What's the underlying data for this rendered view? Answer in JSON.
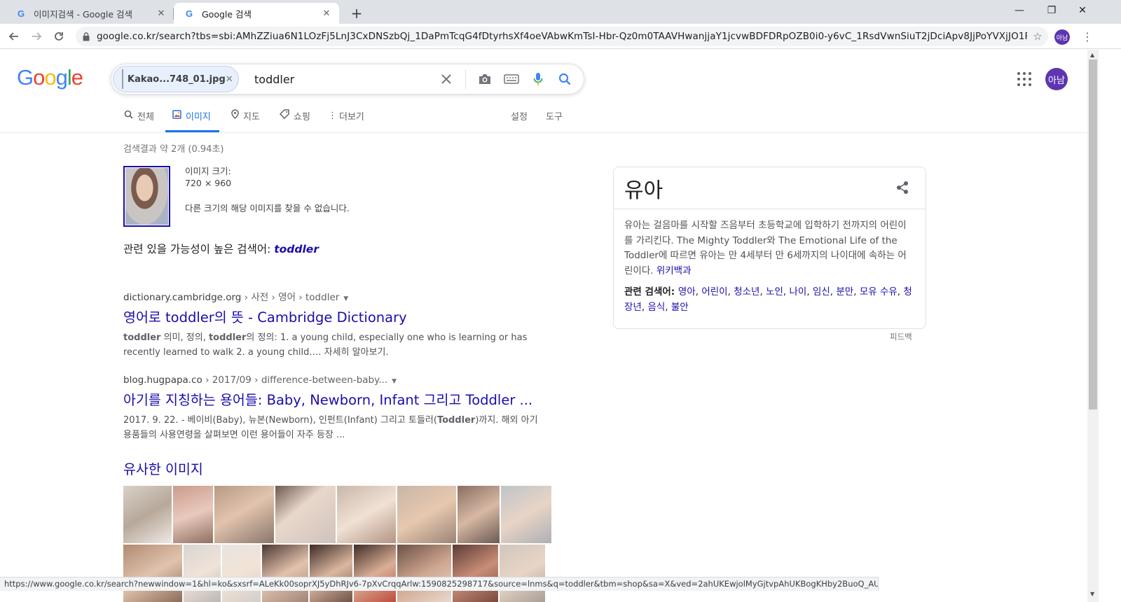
{
  "browser": {
    "tabs": [
      {
        "title": "이미지검색 - Google 검색",
        "active": false
      },
      {
        "title": "Google 검색",
        "active": true
      }
    ],
    "url": "google.co.kr/search?tbs=sbi:AMhZZiua6N1LOzFj5LnJ3CxDNSzbQj_1DaPmTcqG4fDtyrhsXf4oeVAbwKmTsI-Hbr-Qz0m0TAAVHwanjjaY1jcvwBDFDRpOZB0i0-y6vC_1RsdVwnSiuT2jDciApv8JjPoYVXjJO1RHeSNxLV30W...",
    "profile_label": "아남"
  },
  "search": {
    "logo": "Google",
    "image_chip": "Kakao...748_01.jpg",
    "query": "toddler"
  },
  "user": {
    "avatar_label": "아남"
  },
  "nav": {
    "tabs": [
      {
        "label": "전체",
        "icon": "search-icon",
        "active": false
      },
      {
        "label": "이미지",
        "icon": "image-icon",
        "active": true
      },
      {
        "label": "지도",
        "icon": "map-pin-icon",
        "active": false
      },
      {
        "label": "쇼핑",
        "icon": "tag-icon",
        "active": false
      },
      {
        "label": "더보기",
        "icon": "more-vert-icon",
        "active": false
      }
    ],
    "settings": "설정",
    "tools": "도구"
  },
  "stats": "검색결과 약 2개 (0.94초)",
  "image_info": {
    "size_label": "이미지 크기:",
    "size_value": "720 × 960",
    "not_found": "다른 크기의 해당 이미지를 찾을 수 없습니다."
  },
  "best_guess": {
    "label": "관련 있을 가능성이 높은 검색어: ",
    "term": "toddler"
  },
  "results": [
    {
      "domain": "dictionary.cambridge.org",
      "path": " › 사전 › 영어 › toddler",
      "title": "영어로 toddler의 뜻 - Cambridge Dictionary",
      "snippet_b1": "toddler",
      "snippet_t1": " 의미, 정의, ",
      "snippet_b2": "toddler",
      "snippet_t2": "의 정의: 1. a young child, especially one who is learning or has recently learned to walk 2. a young child.… 자세히 알아보기."
    },
    {
      "domain": "blog.hugpapa.co",
      "path": " › 2017/09 › difference-between-baby...",
      "title": "아기를 지칭하는 용어들: Baby, Newborn, Infant 그리고 Toddler ...",
      "snippet_t1": "2017. 9. 22. - 베이비(Baby), 뉴본(Newborn), 인펀트(Infant) 그리고 토들러(",
      "snippet_b1": "Toddler",
      "snippet_t2": ")까지. 해외 아기용품들의 사용연령을 살펴보면 이런 용어들이 자주 등장 ..."
    }
  ],
  "similar_images": {
    "heading": "유사한 이미지"
  },
  "knowledge_panel": {
    "title": "유아",
    "description": "유아는 걸음마를 시작할 즈음부터 초등학교에 입학하기 전까지의 어린이를 가리킨다. The Mighty Toddler와 The Emotional Life of the Toddler에 따르면 유아는 만 4세부터 만 6세까지의 나이대에 속하는 어린이다. ",
    "source_link": "위키백과",
    "related_label": "관련 검색어: ",
    "related": [
      "영아",
      "어린이",
      "청소년",
      "노인",
      "나이",
      "임신",
      "분만",
      "모유 수유",
      "청장년",
      "음식",
      "불안"
    ],
    "feedback": "피드백"
  },
  "status_url": "https://www.google.co.kr/search?newwindow=1&hl=ko&sxsrf=ALeKk00soprXJ5yDhRJv6-7pXvCrqqArlw:1590825298717&source=lnms&q=toddler&tbm=shop&sa=X&ved=2ahUKEwjolMyGjtvpAhUKBogKHby2BuoQ_AUoA3oECAwQBQ"
}
